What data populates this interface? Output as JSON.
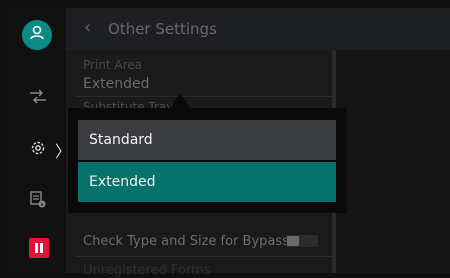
{
  "header": {
    "title": "Other Settings"
  },
  "settings_list": {
    "print_area": {
      "label": "Print Area",
      "value": "Extended"
    },
    "substitute_tray": {
      "label": "Substitute Tray"
    },
    "check_type_size": {
      "label": "Check Type and Size for Bypass",
      "toggle_on": false
    },
    "unregistered_forms": {
      "label": "Unregistered Forms"
    }
  },
  "dropdown": {
    "options": [
      "Standard",
      "Extended"
    ],
    "selected": "Extended"
  },
  "colors": {
    "accent": "#06726b",
    "user_button": "#0b8b86",
    "stop_button": "#e3123b"
  },
  "icons": {
    "user": "user-icon",
    "jobs": "jobs-icon",
    "settings": "gear-icon",
    "printer_info": "printer-info-icon",
    "stop": "stop-icon",
    "back": "chevron-left-icon"
  }
}
